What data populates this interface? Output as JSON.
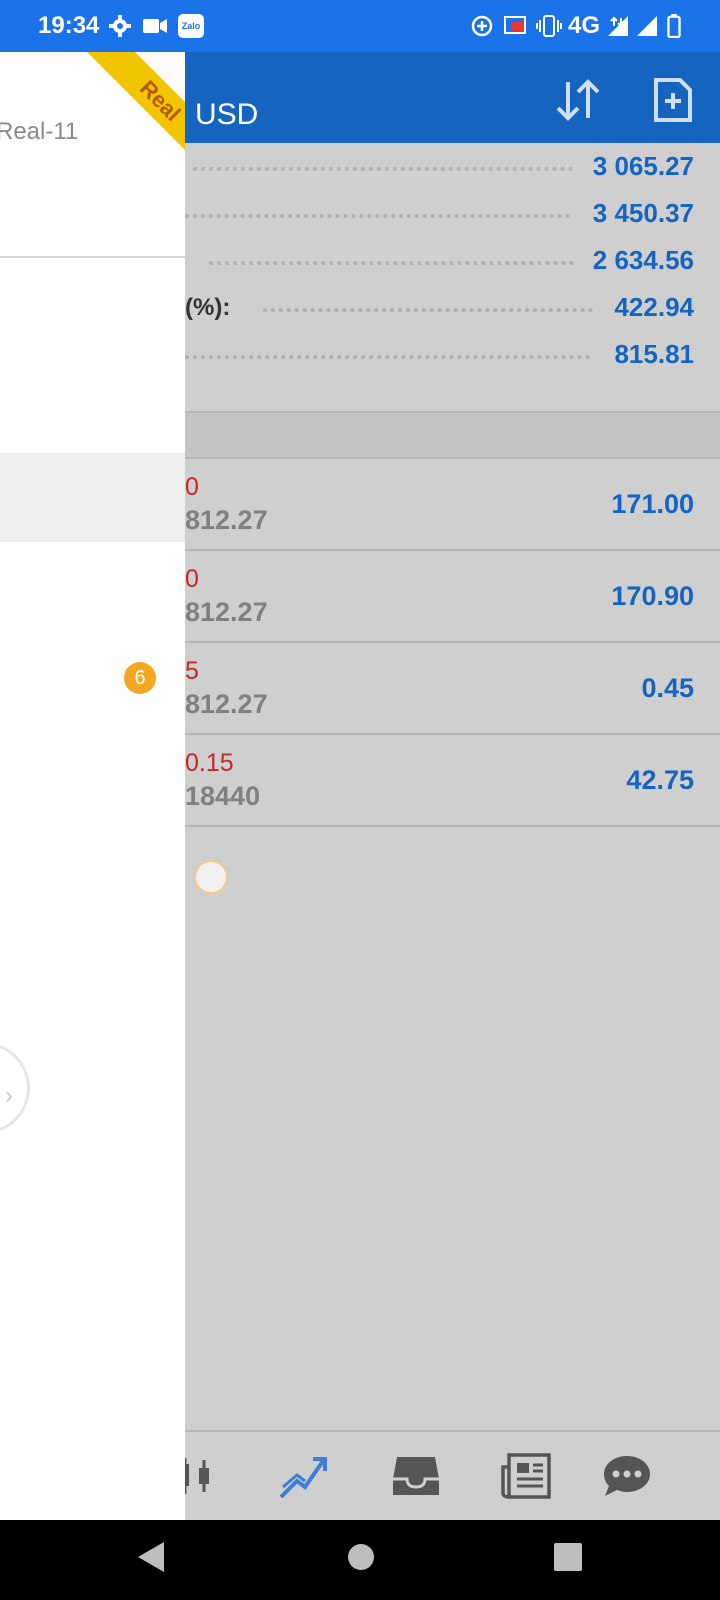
{
  "status_bar": {
    "time": "19:34",
    "network": "4G",
    "icons": [
      "settings-icon",
      "video-icon",
      "zalo-icon",
      "data-saver-icon",
      "cast-icon",
      "vibrate-icon",
      "wifi-arrows-icon",
      "signal-icon",
      "battery-icon"
    ],
    "zalo_label": "Zalo"
  },
  "header": {
    "currency": "USD",
    "sort_icon": "sort-icon",
    "new_order_icon": "new-order-icon"
  },
  "drawer": {
    "ribbon": "Real",
    "account": "Real-11",
    "badge": "6"
  },
  "summary": {
    "rows": [
      {
        "label": "",
        "value": "3 065.27"
      },
      {
        "label": "",
        "value": "3 450.37"
      },
      {
        "label": "",
        "value": "2 634.56"
      },
      {
        "label": "(%):",
        "value": "422.94"
      },
      {
        "label": "",
        "value": "815.81"
      }
    ]
  },
  "positions": [
    {
      "top": "0",
      "bottom": "812.27",
      "profit": "171.00"
    },
    {
      "top": "0",
      "bottom": "812.27",
      "profit": "170.90"
    },
    {
      "top": "5",
      "bottom": "812.27",
      "profit": "0.45"
    },
    {
      "top": "0.15",
      "bottom": "18440",
      "profit": "42.75"
    }
  ],
  "tabs": [
    "chart-icon",
    "trade-icon",
    "history-icon",
    "news-icon",
    "chat-icon"
  ],
  "colors": {
    "accent": "#1565c0",
    "loss": "#c62828",
    "badge": "#f5a623",
    "ribbon": "#f2c500"
  }
}
